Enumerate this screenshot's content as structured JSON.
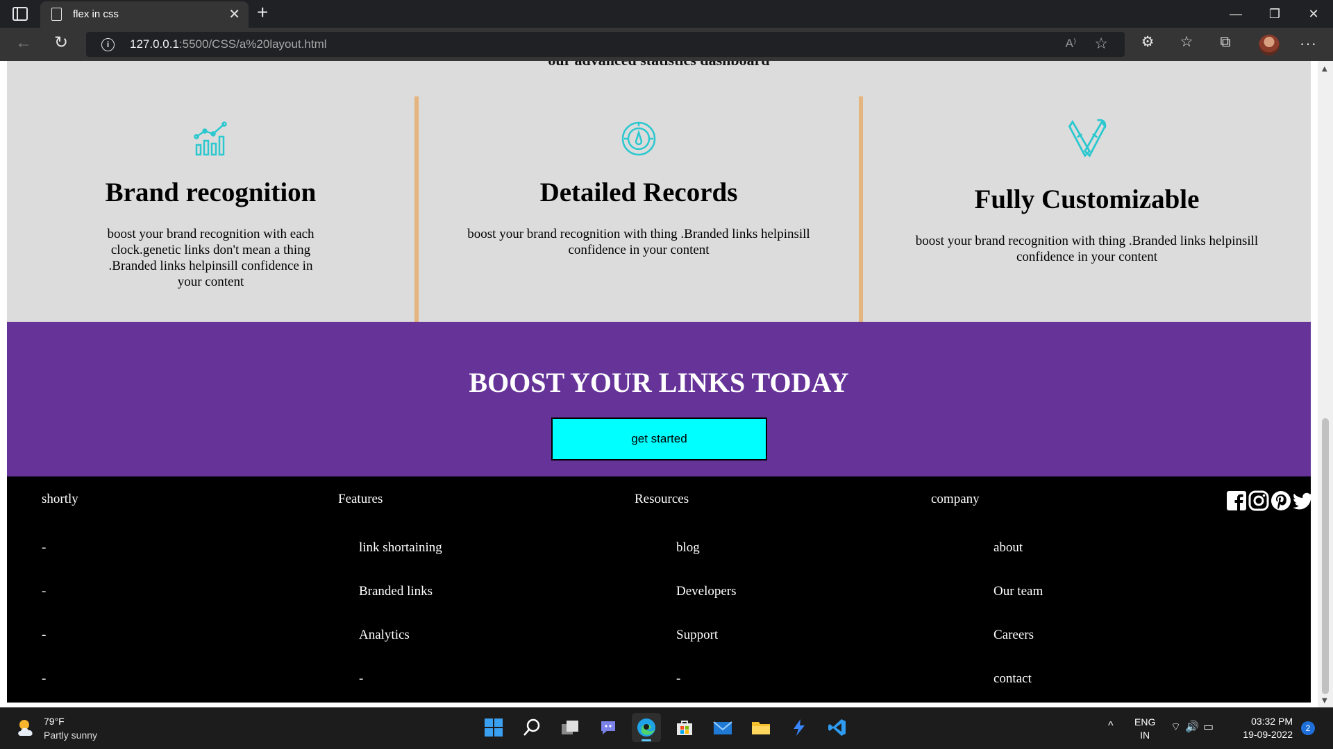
{
  "browser": {
    "tab_title": "flex in css",
    "tab_close": "✕",
    "new_tab": "+",
    "url_host": "127.0.0.1",
    "url_rest": ":5500/CSS/a%20layout.html",
    "window_controls": {
      "minimize": "—",
      "restore": "❐",
      "close": "✕"
    },
    "more": "···"
  },
  "page": {
    "cut_heading": "our advanced statistics dashboard",
    "features": [
      {
        "title": "Brand recognition",
        "icon": "bar-chart-icon",
        "text": "boost your brand recognition with each clock.genetic links don't mean a thing .Branded links helpinsill confidence in your content"
      },
      {
        "title": "Detailed Records",
        "icon": "gauge-icon",
        "text": "boost your brand recognition with thing .Branded links helpinsill confidence in your content"
      },
      {
        "title": "Fully Customizable",
        "icon": "pen-brush-icon",
        "text": "boost your brand recognition with thing .Branded links helpinsill confidence in your content"
      }
    ],
    "boost": {
      "title": "BOOST YOUR LINKS TODAY",
      "cta": "get started"
    },
    "footer": {
      "columns": [
        {
          "heading": "shortly",
          "items": [
            "-",
            "-",
            "-",
            "-"
          ]
        },
        {
          "heading": "Features",
          "items": [
            "link shortaining",
            "Branded links",
            "Analytics",
            "-"
          ]
        },
        {
          "heading": "Resources",
          "items": [
            "blog",
            "Developers",
            "Support",
            "-"
          ]
        },
        {
          "heading": "company",
          "items": [
            "about",
            "Our team",
            "Careers",
            "contact"
          ]
        }
      ],
      "socials": [
        "facebook-icon",
        "instagram-icon",
        "pinterest-icon",
        "twitter-icon"
      ]
    }
  },
  "taskbar": {
    "temperature": "79°F",
    "weather": "Partly sunny",
    "lang_1": "ENG",
    "lang_2": "IN",
    "time": "03:32 PM",
    "date": "19-09-2022",
    "notifications": "2"
  },
  "colors": {
    "features_bg": "#dcdcdc",
    "divider": "#e4b57e",
    "icon_accent": "#2bc8cf",
    "boost_bg": "#663399",
    "cta_bg": "#00ffff",
    "footer_bg": "#000000"
  }
}
